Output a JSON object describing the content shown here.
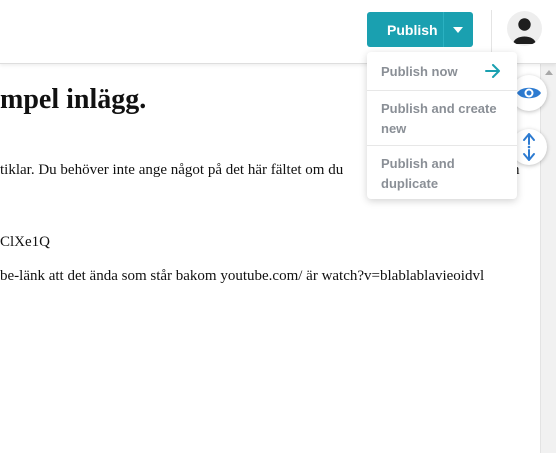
{
  "toolbar": {
    "publish_label": "Publish",
    "dropdown_items": [
      {
        "label": "Publish now"
      },
      {
        "label": "Publish and create new"
      },
      {
        "label": "Publish and duplicate"
      }
    ]
  },
  "content": {
    "title": "mpel inlägg.",
    "paragraph_1": "tiklar. Du behöver inte ange något på det här fältet om du",
    "paragraph_1_tail": "n",
    "paragraph_2": "ClXe1Q",
    "paragraph_3": "be-länk att det ända som står bakom youtube.com/ är watch?v=blablablavieoidvl"
  },
  "colors": {
    "accent": "#1aa0b0",
    "icon_blue": "#2d7bd1",
    "menu_text": "#8a8f96"
  },
  "icons": [
    "caret-down-icon",
    "user-avatar-icon",
    "eye-icon",
    "arrow-right-icon",
    "expand-vertical-icon"
  ]
}
